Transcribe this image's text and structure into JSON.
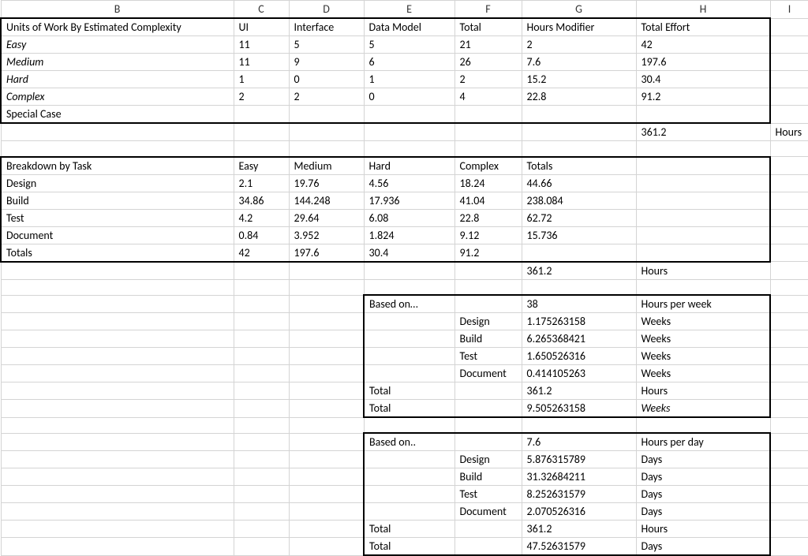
{
  "columns": [
    "B",
    "C",
    "D",
    "E",
    "F",
    "G",
    "H",
    "I"
  ],
  "section1": {
    "title": "Units of Work By Estimated Complexity",
    "headers": {
      "c": "UI",
      "d": "Interface",
      "e": "Data Model",
      "f": "Total",
      "g": "Hours Modifier",
      "h": "Total Effort"
    },
    "rows": [
      {
        "label": "Easy",
        "c": "11",
        "d": "5",
        "e": "5",
        "f": "21",
        "g": "2",
        "h": "42"
      },
      {
        "label": "Medium",
        "c": "11",
        "d": "9",
        "e": "6",
        "f": "26",
        "g": "7.6",
        "h": "197.6"
      },
      {
        "label": "Hard",
        "c": "1",
        "d": "0",
        "e": "1",
        "f": "2",
        "g": "15.2",
        "h": "30.4"
      },
      {
        "label": "Complex",
        "c": "2",
        "d": "2",
        "e": "0",
        "f": "4",
        "g": "22.8",
        "h": "91.2"
      }
    ],
    "special_label": "Special Case",
    "total_effort": "361.2",
    "total_effort_unit": "Hours"
  },
  "section2": {
    "title": "Breakdown by Task",
    "headers": {
      "c": "Easy",
      "d": "Medium",
      "e": "Hard",
      "f": "Complex",
      "g": "Totals"
    },
    "rows": [
      {
        "label": "Design",
        "c": "2.1",
        "d": "19.76",
        "e": "4.56",
        "f": "18.24",
        "g": "44.66"
      },
      {
        "label": "Build",
        "c": "34.86",
        "d": "144.248",
        "e": "17.936",
        "f": "41.04",
        "g": "238.084"
      },
      {
        "label": "Test",
        "c": "4.2",
        "d": "29.64",
        "e": "6.08",
        "f": "22.8",
        "g": "62.72"
      },
      {
        "label": "Document",
        "c": "0.84",
        "d": "3.952",
        "e": "1.824",
        "f": "9.12",
        "g": "15.736"
      }
    ],
    "totals_row": {
      "label": "Totals",
      "c": "42",
      "d": "197.6",
      "e": "30.4",
      "f": "91.2"
    },
    "grand_total": "361.2",
    "grand_total_unit": "Hours"
  },
  "weeks": {
    "based_on": "Based on…",
    "qty": "38",
    "unit": "Hours per week",
    "rows": [
      {
        "label": "Design",
        "val": "1.175263158",
        "unit": "Weeks"
      },
      {
        "label": "Build",
        "val": "6.265368421",
        "unit": "Weeks"
      },
      {
        "label": "Test",
        "val": "1.650526316",
        "unit": "Weeks"
      },
      {
        "label": "Document",
        "val": "0.414105263",
        "unit": "Weeks"
      }
    ],
    "total1_label": "Total",
    "total1_val": "361.2",
    "total1_unit": "Hours",
    "total2_label": "Total",
    "total2_val": "9.505263158",
    "total2_unit": "Weeks"
  },
  "days": {
    "based_on": "Based on..",
    "qty": "7.6",
    "unit": "Hours per day",
    "rows": [
      {
        "label": "Design",
        "val": "5.876315789",
        "unit": "Days"
      },
      {
        "label": "Build",
        "val": "31.32684211",
        "unit": "Days"
      },
      {
        "label": "Test",
        "val": "8.252631579",
        "unit": "Days"
      },
      {
        "label": "Document",
        "val": "2.070526316",
        "unit": "Days"
      }
    ],
    "total1_label": "Total",
    "total1_val": "361.2",
    "total1_unit": "Hours",
    "total2_label": "Total",
    "total2_val": "47.52631579",
    "total2_unit": "Days"
  }
}
